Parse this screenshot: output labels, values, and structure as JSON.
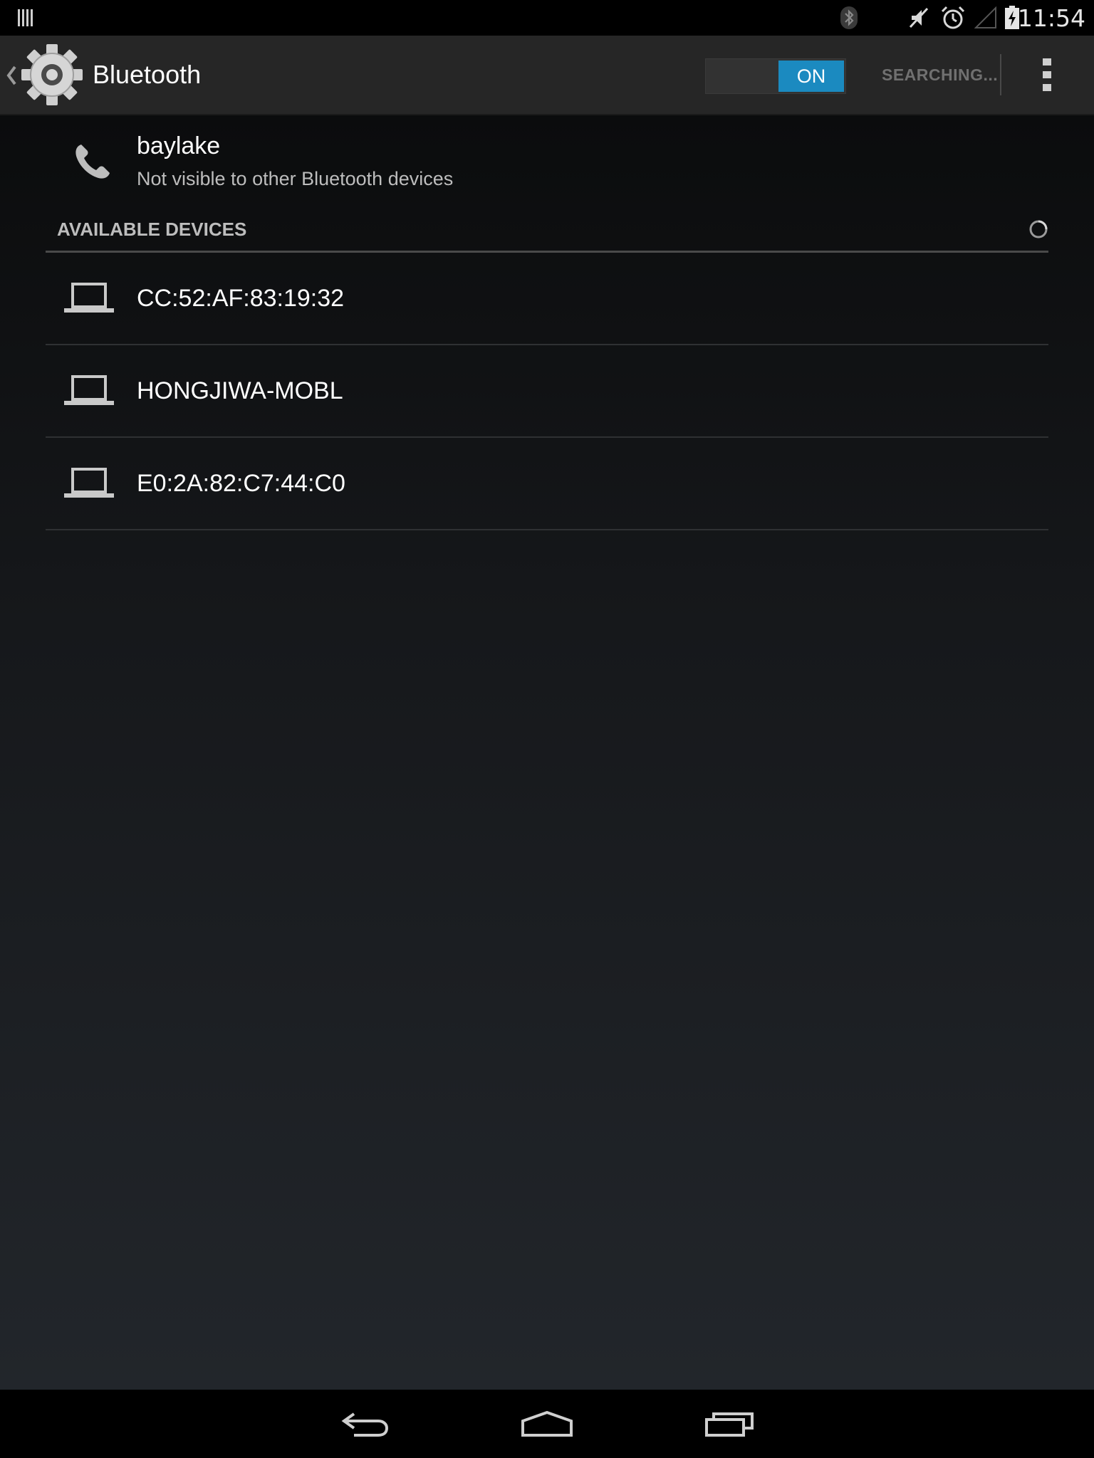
{
  "status_bar": {
    "time": "11:54",
    "icons": [
      "notification-icon",
      "bluetooth-icon",
      "mute-icon",
      "alarm-icon",
      "signal-icon",
      "battery-charging-icon"
    ]
  },
  "action_bar": {
    "title": "Bluetooth",
    "toggle_label": "ON",
    "toggle_state": "on",
    "search_label": "SEARCHING...",
    "accent_color": "#1b8ac0"
  },
  "local_device": {
    "name": "baylake",
    "summary": "Not visible to other Bluetooth devices"
  },
  "available_devices": {
    "header": "AVAILABLE DEVICES",
    "items": [
      {
        "name": "CC:52:AF:83:19:32",
        "icon": "laptop-icon"
      },
      {
        "name": "HONGJIWA-MOBL",
        "icon": "laptop-icon"
      },
      {
        "name": "E0:2A:82:C7:44:C0",
        "icon": "laptop-icon"
      }
    ]
  },
  "nav_bar": {
    "buttons": [
      "back-icon",
      "home-icon",
      "recents-icon"
    ]
  }
}
